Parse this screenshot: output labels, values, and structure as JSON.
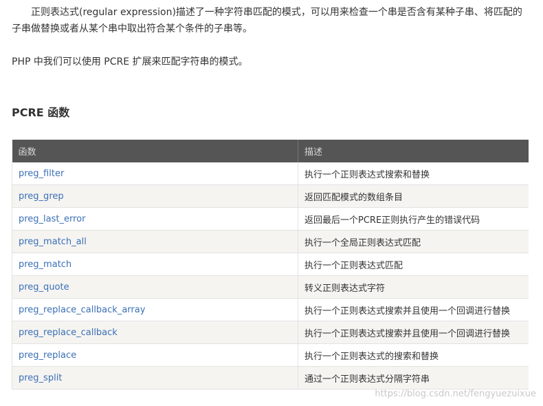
{
  "article": {
    "intro": "正则表达式(regular expression)描述了一种字符串匹配的模式，可以用来检查一个串是否含有某种子串、将匹配的子串做替换或者从某个串中取出符合某个条件的子串等。",
    "php_note": "PHP 中我们可以使用 PCRE 扩展来匹配字符串的模式。",
    "section_title": "PCRE 函数"
  },
  "table": {
    "headers": [
      "函数",
      "描述"
    ],
    "rows": [
      {
        "name": "preg_filter",
        "desc": "执行一个正则表达式搜索和替换"
      },
      {
        "name": "preg_grep",
        "desc": "返回匹配模式的数组条目"
      },
      {
        "name": "preg_last_error",
        "desc": "返回最后一个PCRE正则执行产生的错误代码"
      },
      {
        "name": "preg_match_all",
        "desc": "执行一个全局正则表达式匹配"
      },
      {
        "name": "preg_match",
        "desc": "执行一个正则表达式匹配"
      },
      {
        "name": "preg_quote",
        "desc": "转义正则表达式字符"
      },
      {
        "name": "preg_replace_callback_array",
        "desc": "执行一个正则表达式搜索并且使用一个回调进行替换"
      },
      {
        "name": "preg_replace_callback",
        "desc": "执行一个正则表达式搜索并且使用一个回调进行替换"
      },
      {
        "name": "preg_replace",
        "desc": "执行一个正则表达式的搜索和替换"
      },
      {
        "name": "preg_split",
        "desc": "通过一个正则表达式分隔字符串"
      }
    ]
  },
  "watermark": "https://blog.csdn.net/fengyuezuixue",
  "colors": {
    "header_bg": "#555555",
    "link": "#3a6fb6",
    "row_alt": "#f5f4f1"
  }
}
